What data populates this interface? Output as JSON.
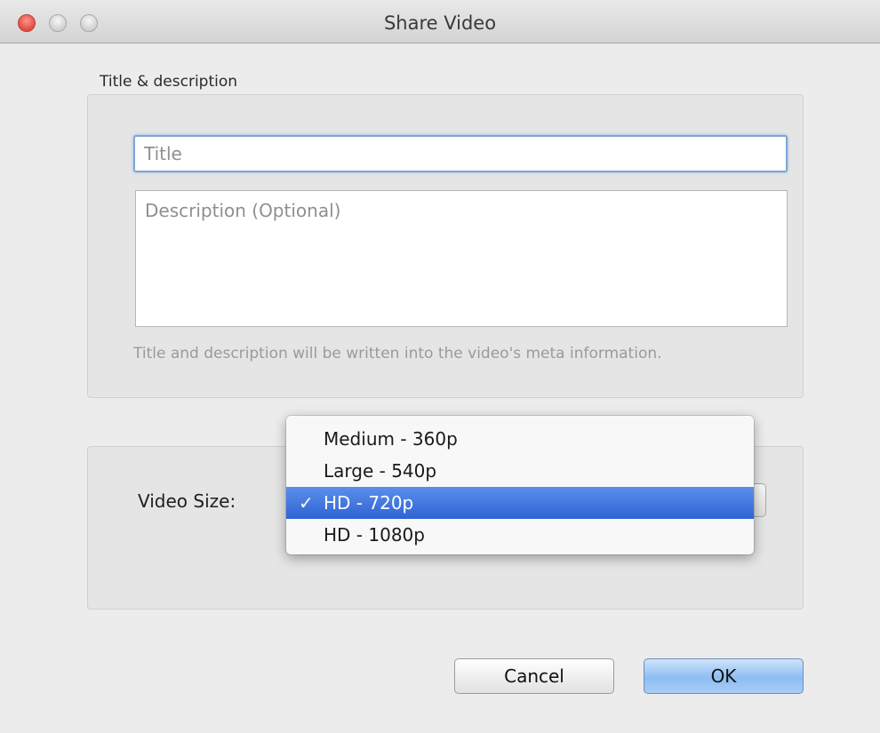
{
  "window": {
    "title": "Share Video"
  },
  "meta_group": {
    "label": "Title & description",
    "title_placeholder": "Title",
    "description_placeholder": "Description (Optional)",
    "hint": "Title and description will be written into the video's meta information."
  },
  "size_group": {
    "label": "Video Size:",
    "options": [
      {
        "label": "Medium - 360p",
        "selected": false
      },
      {
        "label": "Large - 540p",
        "selected": false
      },
      {
        "label": "HD - 720p",
        "selected": true
      },
      {
        "label": "HD - 1080p",
        "selected": false
      }
    ],
    "check_glyph": "✓"
  },
  "buttons": {
    "cancel": "Cancel",
    "ok": "OK"
  }
}
